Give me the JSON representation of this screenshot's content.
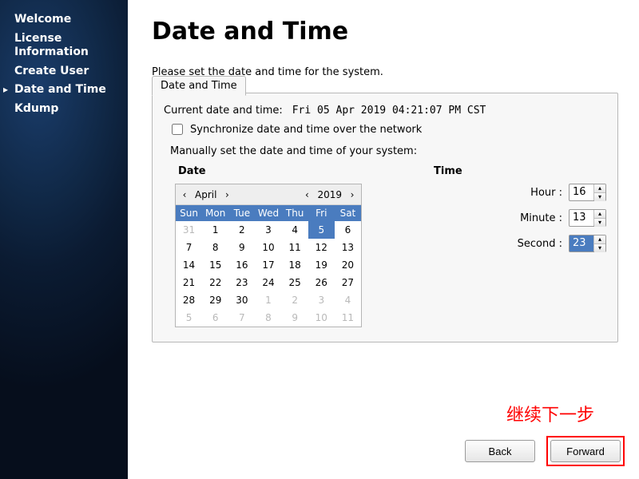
{
  "sidebar": {
    "items": [
      {
        "label": "Welcome"
      },
      {
        "label": "License Information"
      },
      {
        "label": "Create User"
      },
      {
        "label": "Date and Time"
      },
      {
        "label": "Kdump"
      }
    ],
    "current_index": 3
  },
  "page": {
    "title": "Date and Time",
    "intro": "Please set the date and time for the system.",
    "tab_label": "Date and Time"
  },
  "current": {
    "prefix": "Current date and time:",
    "value": "Fri 05 Apr 2019 04:21:07 PM CST"
  },
  "sync": {
    "checked": false,
    "label": "Synchronize date and time over the network"
  },
  "manual_label": "Manually set the date and time of your system:",
  "date": {
    "section": "Date",
    "month": "April",
    "year": "2019",
    "weekdays": [
      "Sun",
      "Mon",
      "Tue",
      "Wed",
      "Thu",
      "Fri",
      "Sat"
    ],
    "weeks": [
      [
        {
          "d": "31",
          "o": true
        },
        {
          "d": "1"
        },
        {
          "d": "2"
        },
        {
          "d": "3"
        },
        {
          "d": "4"
        },
        {
          "d": "5",
          "today": true
        },
        {
          "d": "6"
        }
      ],
      [
        {
          "d": "7"
        },
        {
          "d": "8"
        },
        {
          "d": "9"
        },
        {
          "d": "10"
        },
        {
          "d": "11"
        },
        {
          "d": "12"
        },
        {
          "d": "13"
        }
      ],
      [
        {
          "d": "14"
        },
        {
          "d": "15"
        },
        {
          "d": "16"
        },
        {
          "d": "17"
        },
        {
          "d": "18"
        },
        {
          "d": "19"
        },
        {
          "d": "20"
        }
      ],
      [
        {
          "d": "21"
        },
        {
          "d": "22"
        },
        {
          "d": "23"
        },
        {
          "d": "24"
        },
        {
          "d": "25"
        },
        {
          "d": "26"
        },
        {
          "d": "27"
        }
      ],
      [
        {
          "d": "28"
        },
        {
          "d": "29"
        },
        {
          "d": "30"
        },
        {
          "d": "1",
          "o": true
        },
        {
          "d": "2",
          "o": true
        },
        {
          "d": "3",
          "o": true
        },
        {
          "d": "4",
          "o": true
        }
      ],
      [
        {
          "d": "5",
          "o": true
        },
        {
          "d": "6",
          "o": true
        },
        {
          "d": "7",
          "o": true
        },
        {
          "d": "8",
          "o": true
        },
        {
          "d": "9",
          "o": true
        },
        {
          "d": "10",
          "o": true
        },
        {
          "d": "11",
          "o": true
        }
      ]
    ]
  },
  "time": {
    "section": "Time",
    "hour": {
      "label": "Hour :",
      "value": "16"
    },
    "minute": {
      "label": "Minute :",
      "value": "13"
    },
    "second": {
      "label": "Second :",
      "value": "23",
      "selected": true
    }
  },
  "annotation": "继续下一步",
  "footer": {
    "back": "Back",
    "forward": "Forward"
  },
  "glyph": {
    "left": "‹",
    "right": "›",
    "up": "▴",
    "down": "▾"
  }
}
